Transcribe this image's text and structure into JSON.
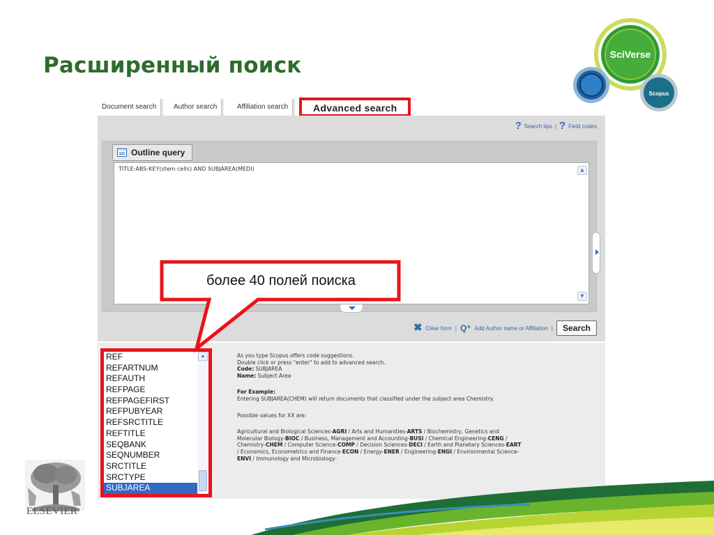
{
  "slide": {
    "title": "Расширенный поиск"
  },
  "logo": {
    "brand": "SciVerse",
    "product": "Scopus"
  },
  "tabs": [
    {
      "label": "Document search"
    },
    {
      "label": "Author search"
    },
    {
      "label": "Affiliation search"
    },
    {
      "label": "Advanced search",
      "active": true
    }
  ],
  "help": {
    "search_tips": "Search tips",
    "separator": "|",
    "field_codes": "Field codes"
  },
  "outline": {
    "label": "Outline query"
  },
  "query": {
    "value": "TITLE-ABS-KEY(stem cells) AND SUBJAREA(MEDI)"
  },
  "actions": {
    "clear_form": "Clear form",
    "separator": "|",
    "add_author": "Add Author name or Affiliation",
    "search": "Search"
  },
  "callout": {
    "text": "более 40 полей поиска"
  },
  "field_list": {
    "items": [
      "REF",
      "REFARTNUM",
      "REFAUTH",
      "REFPAGE",
      "REFPAGEFIRST",
      "REFPUBYEAR",
      "REFSRCTITLE",
      "REFTITLE",
      "SEQBANK",
      "SEQNUMBER",
      "SRCTITLE",
      "SRCTYPE",
      "SUBJAREA"
    ],
    "selected": "SUBJAREA"
  },
  "description": {
    "line1": "As you type Scopus offers code suggestions.",
    "line2": "Double click or press \"enter\" to add to advanced search.",
    "code_label": "Code:",
    "code_value": "SUBJAREA",
    "name_label": "Name:",
    "name_value": "Subject Area",
    "example_label": "For Example:",
    "example_text": "Entering SUBJAREA(CHEM) will return documents that classified under the subject area Chemistry.",
    "possible_label": "Possible values for XX are:",
    "values_text_1": "Agricultural and Biological Sciences-",
    "v1": "AGRI",
    "values_text_2": " / Arts and Humanities-",
    "v2": "ARTS",
    "values_text_3": " / Biochemistry, Genetics and Molecular Biology-",
    "v3": "BIOC",
    "values_text_4": " / Business, Management and Accounting-",
    "v4": "BUSI",
    "values_text_5": " / Chemical Engineering-",
    "v5": "CENG",
    "values_text_6": " / Chemistry-",
    "v6": "CHEM",
    "values_text_7": " / Computer Science-",
    "v7": "COMP",
    "values_text_8": " / Decision Sciences-",
    "v8": "DECI",
    "values_text_9": " / Earth and Planetary Sciences-",
    "v9": "EART",
    "values_text_10": " / Economics, Econometrics and Finance-",
    "v10": "ECON",
    "values_text_11": " / Energy-",
    "v11": "ENER",
    "values_text_12": " / Engineering-",
    "v12": "ENGI",
    "values_text_13": " / Environmental Science-",
    "v13": "ENVI",
    "values_text_14": " / Immunology and Microbiology-"
  },
  "publisher": {
    "name": "ELSEVIER"
  },
  "colors": {
    "title_green": "#2e6b2e",
    "highlight_red": "#e8141c",
    "link_blue": "#3a62b4",
    "selection_blue": "#316ac5"
  }
}
